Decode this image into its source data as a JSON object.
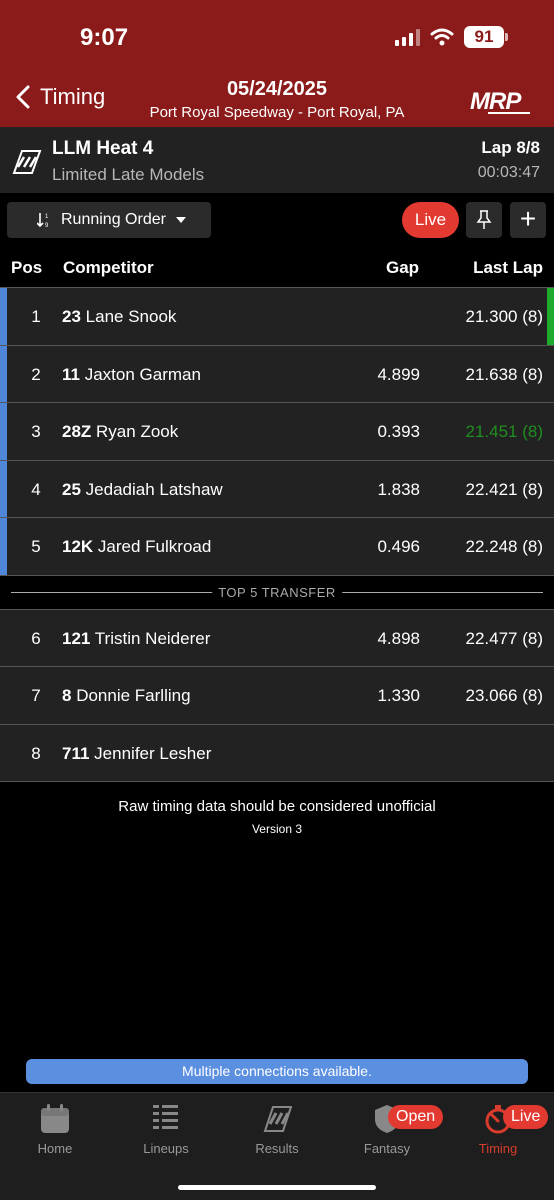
{
  "status": {
    "time": "9:07",
    "battery": "91"
  },
  "header": {
    "back_label": "Timing",
    "date": "05/24/2025",
    "track": "Port Royal Speedway - Port Royal, PA",
    "brand": "MRP"
  },
  "event": {
    "title": "LLM Heat 4",
    "class": "Limited Late Models",
    "lap": "Lap 8/8",
    "elapsed": "00:03:47"
  },
  "toolbar": {
    "order_label": "Running Order",
    "live_label": "Live"
  },
  "columns": {
    "pos": "Pos",
    "competitor": "Competitor",
    "gap": "Gap",
    "last_lap": "Last Lap"
  },
  "rows": [
    {
      "pos": "1",
      "number": "23",
      "name": "Lane Snook",
      "gap": "",
      "last_lap": "21.300 (8)"
    },
    {
      "pos": "2",
      "number": "11",
      "name": "Jaxton Garman",
      "gap": "4.899",
      "last_lap": "21.638 (8)"
    },
    {
      "pos": "3",
      "number": "28Z",
      "name": "Ryan Zook",
      "gap": "0.393",
      "last_lap": "21.451 (8)"
    },
    {
      "pos": "4",
      "number": "25",
      "name": "Jedadiah Latshaw",
      "gap": "1.838",
      "last_lap": "22.421 (8)"
    },
    {
      "pos": "5",
      "number": "12K",
      "name": "Jared Fulkroad",
      "gap": "0.496",
      "last_lap": "22.248 (8)"
    },
    {
      "pos": "6",
      "number": "121",
      "name": "Tristin Neiderer",
      "gap": "4.898",
      "last_lap": "22.477 (8)"
    },
    {
      "pos": "7",
      "number": "8",
      "name": "Donnie Farlling",
      "gap": "1.330",
      "last_lap": "23.066 (8)"
    },
    {
      "pos": "8",
      "number": "711",
      "name": "Jennifer Lesher",
      "gap": "",
      "last_lap": ""
    }
  ],
  "transfer_label": "TOP 5 TRANSFER",
  "disclaimer": "Raw timing data should be considered unofficial",
  "version": "Version 3",
  "connection_banner": "Multiple connections available.",
  "tabs": [
    {
      "label": "Home",
      "icon": "calendar-icon"
    },
    {
      "label": "Lineups",
      "icon": "list-icon"
    },
    {
      "label": "Results",
      "icon": "checkered-flag-icon"
    },
    {
      "label": "Fantasy",
      "icon": "shield-icon",
      "badge": "Open"
    },
    {
      "label": "Timing",
      "icon": "stopwatch-icon",
      "badge": "Live"
    }
  ],
  "colors": {
    "header": "#8b1a1a",
    "accent": "#e23a30",
    "leader_bar": "#4f86d8",
    "best_lap": "#1f8f1f"
  }
}
